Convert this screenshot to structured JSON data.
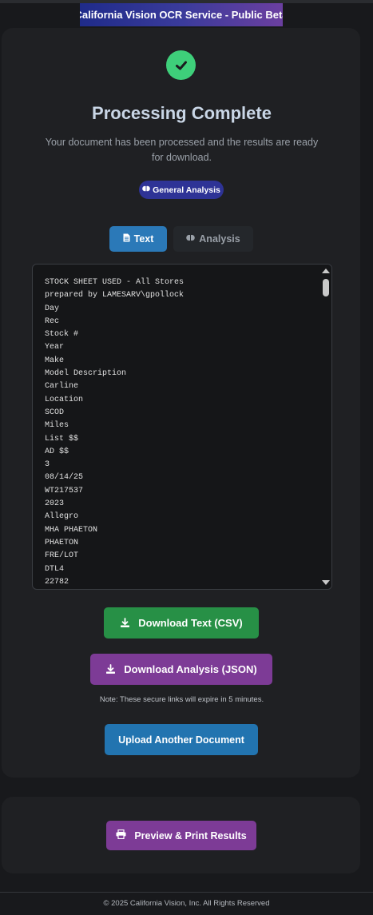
{
  "header": {
    "banner_text": "California Vision OCR Service - Public Beta"
  },
  "status": {
    "icon": "check-circle-icon",
    "title": "Processing Complete",
    "message": "Your document has been processed and the results are ready for download.",
    "badge_label": "General Analysis",
    "badge_icon": "brain-icon"
  },
  "tabs": [
    {
      "label": "Text",
      "icon": "file-text-icon",
      "active": true
    },
    {
      "label": "Analysis",
      "icon": "brain-icon",
      "active": false
    }
  ],
  "ocr_text": {
    "lines": [
      "STOCK SHEET USED - All Stores",
      "prepared by LAMESARV\\gpollock",
      "Day",
      "Rec",
      "Stock #",
      "Year",
      "Make",
      "Model Description",
      "Carline",
      "Location",
      "SCOD",
      "Miles",
      "List $$",
      "AD $$",
      "3",
      "08/14/25",
      "WT217537",
      "2023",
      "Allegro",
      "MHA PHAETON",
      "PHAETON",
      "FRE/LOT",
      "DTL4",
      "22782"
    ]
  },
  "actions": {
    "download_text_label": "Download Text (CSV)",
    "download_analysis_label": "Download Analysis (JSON)",
    "expiry_note": "Note: These secure links will expire in 5 minutes.",
    "upload_another_label": "Upload Another Document",
    "preview_print_label": "Preview & Print Results"
  },
  "footer": {
    "copyright": "© 2025 California Vision, Inc. All Rights Reserved"
  },
  "colors": {
    "background": "#18191c",
    "card": "#1f2023",
    "success": "#3ecf7a",
    "primary_blue": "#2b79b8",
    "green_button": "#279046",
    "purple_button": "#7d3b96",
    "badge": "#2e3396"
  }
}
